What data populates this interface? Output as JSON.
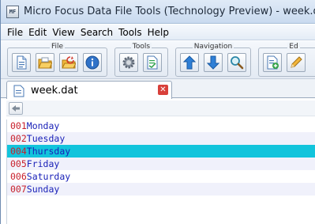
{
  "window": {
    "title": "Micro Focus Data File Tools (Technology Preview) - week.dat"
  },
  "menu": [
    "File",
    "Edit",
    "View",
    "Search",
    "Tools",
    "Help"
  ],
  "toolbar": {
    "groups": [
      {
        "label": "File"
      },
      {
        "label": "Tools"
      },
      {
        "label": "Navigation"
      },
      {
        "label": "Ed"
      }
    ]
  },
  "tab": {
    "label": "week.dat"
  },
  "records": [
    {
      "num": "001",
      "value": "Monday",
      "selected": false
    },
    {
      "num": "002",
      "value": "Tuesday",
      "selected": false
    },
    {
      "num": "004",
      "value": "Thursday",
      "selected": true
    },
    {
      "num": "005",
      "value": "Friday",
      "selected": false
    },
    {
      "num": "006",
      "value": "Saturday",
      "selected": false
    },
    {
      "num": "007",
      "value": "Sunday",
      "selected": false
    }
  ],
  "colors": {
    "selected_row": "#12c4dc",
    "record_number": "#c8202c",
    "record_value": "#1a21b8"
  },
  "icons": [
    "new-file-icon",
    "open-file-icon",
    "reopen-file-icon",
    "info-icon",
    "settings-icon",
    "editor-icon",
    "arrow-up-icon",
    "arrow-down-icon",
    "search-icon",
    "add-record-icon",
    "edit-record-icon",
    "back-arrow-icon",
    "close-icon"
  ]
}
